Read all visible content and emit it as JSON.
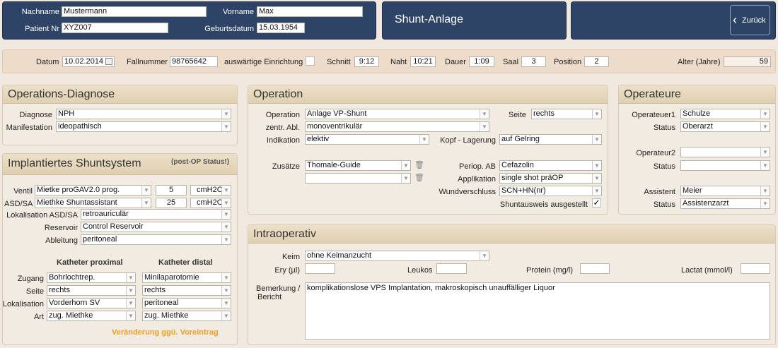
{
  "patient": {
    "nachname_label": "Nachname",
    "nachname": "Mustermann",
    "vorname_label": "Vorname",
    "vorname": "Max",
    "patient_nr_label": "Patient Nr",
    "patient_nr": "XYZ007",
    "geburtsdatum_label": "Geburtsdatum",
    "geburtsdatum": "15.03.1954"
  },
  "title": "Shunt-Anlage",
  "back_label": "Zurück",
  "info": {
    "datum_label": "Datum",
    "datum": "10.02.2014",
    "fallnummer_label": "Fallnummer",
    "fallnummer": "98765642",
    "extern_label": "auswärtige Einrichtung",
    "schnitt_label": "Schnitt",
    "schnitt": "9:12",
    "naht_label": "Naht",
    "naht": "10:21",
    "dauer_label": "Dauer",
    "dauer": "1:09",
    "saal_label": "Saal",
    "saal": "3",
    "position_label": "Position",
    "position": "2",
    "alter_label": "Alter (Jahre)",
    "alter": "59"
  },
  "diagnose": {
    "title": "Operations-Diagnose",
    "diagnose_label": "Diagnose",
    "diagnose": "NPH",
    "manifestation_label": "Manifestation",
    "manifestation": "ideopathisch"
  },
  "shunt": {
    "title": "Implantiertes Shuntsystem",
    "status_note": "(post-OP Status!)",
    "ventil_label": "Ventil",
    "ventil": "Mietke proGAV2.0 prog.",
    "ventil_value": "5",
    "ventil_unit": "cmH2O",
    "asd_label": "ASD/SA",
    "asd": "Miethke Shuntassistant",
    "asd_value": "25",
    "asd_unit": "cmH2O",
    "lokalisation_asd_label": "Lokalisation ASD/SA",
    "lokalisation_asd": "retroauriculär",
    "reservoir_label": "Reservoir",
    "reservoir": "Control Reservoir",
    "ableitung_label": "Ableitung",
    "ableitung": "peritoneal",
    "proximal_header": "Katheter proximal",
    "distal_header": "Katheter distal",
    "zugang_label": "Zugang",
    "zugang_prox": "Bohrlochtrep.",
    "zugang_dist": "Minilaparotomie",
    "seite_label": "Seite",
    "seite_prox": "rechts",
    "seite_dist": "rechts",
    "lokalisation_label": "Lokalisation",
    "lokalisation_prox": "Vorderhorn SV",
    "lokalisation_dist": "peritoneal",
    "art_label": "Art",
    "art_prox": "zug. Miethke",
    "art_dist": "zug. Miethke",
    "change_note": "Veränderung ggü. Voreintrag"
  },
  "operation": {
    "title": "Operation",
    "operation_label": "Operation",
    "operation": "Anlage VP-Shunt",
    "zentr_label": "zentr. Abl.",
    "zentr": "monoventrikulär",
    "indikation_label": "Indikation",
    "indikation": "elektiv",
    "seite_label": "Seite",
    "seite": "rechts",
    "lagerung_label": "Kopf - Lagerung",
    "lagerung": "auf Gelring",
    "zusaetze_label": "Zusätze",
    "zusatz1": "Thomale-Guide",
    "zusatz2": "",
    "periop_label": "Periop. AB",
    "periop": "Cefazolin",
    "applikation_label": "Applikation",
    "applikation": "single shot präOP",
    "wundverschluss_label": "Wundverschluss",
    "wundverschluss": "SCN+HN(nr)",
    "shuntausweis_label": "Shuntausweis ausgestellt",
    "shuntausweis_mark": "✓"
  },
  "operateure": {
    "title": "Operateure",
    "op1_label": "Operateuer1",
    "op1": "Schulze",
    "status_label": "Status",
    "op1_status": "Oberarzt",
    "op2_label": "Operateur2",
    "op2": "",
    "op2_status": "",
    "assistent_label": "Assistent",
    "assistent": "Meier",
    "assistent_status": "Assistenzarzt"
  },
  "intraop": {
    "title": "Intraoperativ",
    "keim_label": "Keim",
    "keim": "ohne Keimanzucht",
    "ery_label": "Ery (µl)",
    "leukos_label": "Leukos",
    "protein_label": "Protein (mg/l)",
    "lactat_label": "Lactat (mmol/l)",
    "bemerkung_label1": "Bemerkung /",
    "bemerkung_label2": "Bericht",
    "bemerkung": "komplikationslose VPS Implantation, makroskopisch unauffälliger Liquor"
  }
}
